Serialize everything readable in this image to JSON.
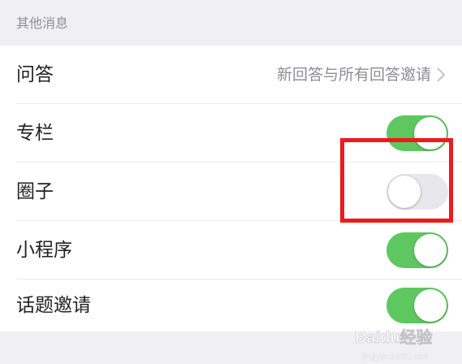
{
  "section": {
    "title": "其他消息"
  },
  "rows": [
    {
      "label": "问答",
      "value": "新回答与所有回答邀请",
      "control": "chevron"
    },
    {
      "label": "专栏",
      "control": "toggle",
      "on": true
    },
    {
      "label": "圈子",
      "control": "toggle",
      "on": false
    },
    {
      "label": "小程序",
      "control": "toggle",
      "on": true
    },
    {
      "label": "话题邀请",
      "control": "toggle",
      "on": true
    }
  ],
  "colors": {
    "toggle_on": "#5fc760",
    "toggle_off": "#e8e8ec",
    "highlight": "#ee1a1a",
    "background": "#efeff4"
  },
  "watermark": {
    "text": "Baidu经验",
    "url": "jingyan.baidu.com"
  }
}
